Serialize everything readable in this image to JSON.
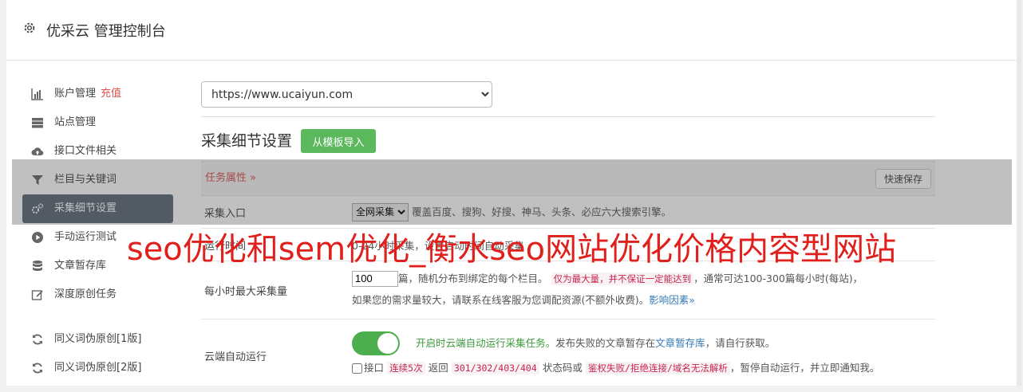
{
  "header": {
    "title": "优采云 管理控制台",
    "icon": "gear-icon"
  },
  "sidebar": {
    "items": [
      {
        "label": "账户管理",
        "extra": "充值",
        "icon": "bar-chart-icon"
      },
      {
        "label": "站点管理",
        "icon": "server-icon"
      },
      {
        "label": "接口文件相关",
        "icon": "cloud-upload-icon"
      },
      {
        "label": "栏目与关键词",
        "icon": "filter-icon"
      },
      {
        "label": "采集细节设置",
        "icon": "cogs-icon",
        "active": true
      },
      {
        "label": "手动运行测试",
        "icon": "play-circle-icon"
      },
      {
        "label": "文章暂存库",
        "icon": "database-icon"
      },
      {
        "label": "深度原创任务",
        "icon": "edit-icon"
      },
      {
        "label": "同义词伪原创[1版]",
        "icon": "refresh-icon"
      },
      {
        "label": "同义词伪原创[2版]",
        "icon": "refresh-icon"
      }
    ]
  },
  "main": {
    "site_select": "https://www.ucaiyun.com",
    "section_title": "采集细节设置",
    "template_button": "从模板导入",
    "task_attr": "任务属性 »",
    "quick_save": "快速保存",
    "entry": {
      "label": "采集入口",
      "select": "全网采集",
      "desc": "覆盖百度、搜狗、好搜、神马、头条、必应六大搜索引擎。"
    },
    "run_time": {
      "label": "运行时间",
      "desc": "0-24小时采集，设置启动时间自动采集"
    },
    "max_per_hour": {
      "label": "每小时最大采集量",
      "value": "100",
      "p1": "篇，随机分布到绑定的每个栏目。",
      "code": "仅为最大量，并不保证一定能达到",
      "p2": "，通常可达100-300篇每小时(每站)，",
      "p3": "如果您的需求量较大，请联系在线客服为您调配资源(不额外收费)。",
      "link": "影响因素»"
    },
    "cloud_run": {
      "label": "云端自动运行",
      "enabled": true,
      "desc_green": "开启时云端自动运行采集任务。",
      "desc_mid": "发布失败的文章暂存在",
      "desc_link": "文章暂存库",
      "desc_end": "，请自行获取。",
      "cb_label": "接口",
      "code1": "连续5次",
      "t1": "返回",
      "code2": "301/302/403/404",
      "t2": "状态码或",
      "code3": "鉴权失败/拒绝连接/域名无法解析",
      "t3": "，暂停自动运行，并立即通知我。"
    }
  },
  "watermark": "seo优化和sem优化_衡水seo网站优化价格内容型网站",
  "colors": {
    "accent_green": "#5cb85c",
    "active_nav": "#5e6a78",
    "danger": "#d9534f",
    "watermark": "#e0201c"
  }
}
